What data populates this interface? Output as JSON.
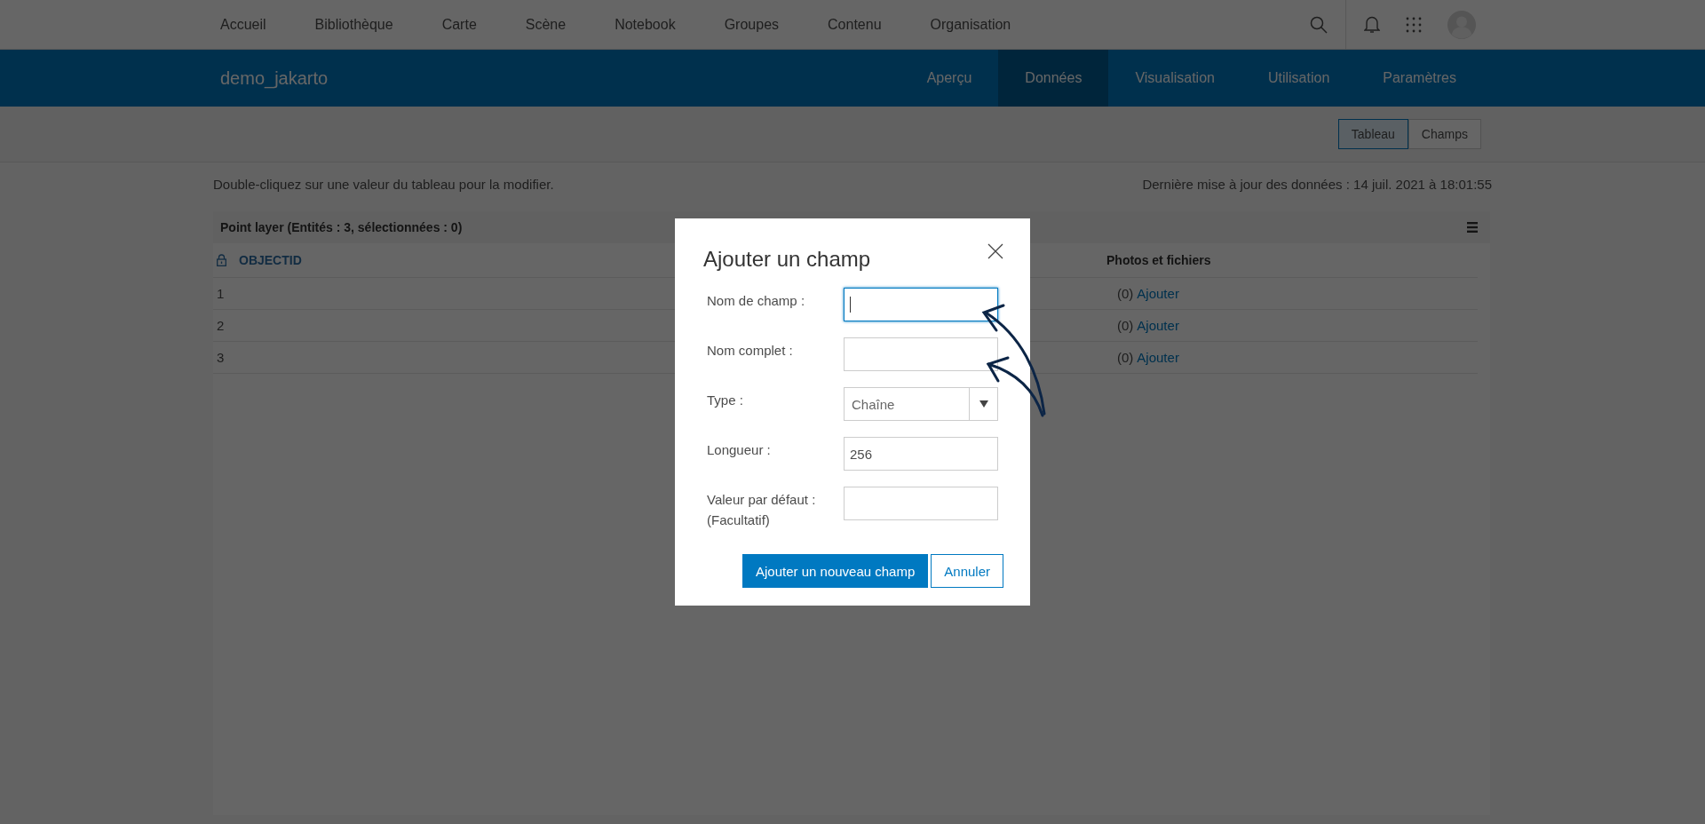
{
  "top_nav": {
    "items": [
      {
        "label": "Accueil"
      },
      {
        "label": "Bibliothèque"
      },
      {
        "label": "Carte"
      },
      {
        "label": "Scène"
      },
      {
        "label": "Notebook"
      },
      {
        "label": "Groupes"
      },
      {
        "label": "Contenu"
      },
      {
        "label": "Organisation"
      }
    ]
  },
  "item_header": {
    "title": "demo_jakarto",
    "tabs": [
      {
        "label": "Aperçu",
        "selected": false
      },
      {
        "label": "Données",
        "selected": true
      },
      {
        "label": "Visualisation",
        "selected": false
      },
      {
        "label": "Utilisation",
        "selected": false
      },
      {
        "label": "Paramètres",
        "selected": false
      }
    ]
  },
  "view_toggle": [
    {
      "label": "Tableau",
      "selected": true
    },
    {
      "label": "Champs",
      "selected": false
    }
  ],
  "hint": "Double-cliquez sur une valeur du tableau pour la modifier.",
  "last_update": "Dernière mise à jour des données : 14 juil. 2021 à 18:01:55",
  "table": {
    "title": "Point layer (Entités : 3, sélectionnées : 0)",
    "columns": [
      {
        "label": "OBJECTID",
        "locked": true
      },
      {
        "label": "Photos et fichiers",
        "locked": false
      }
    ],
    "rows": [
      {
        "id": "1",
        "count": "(0)",
        "link": "Ajouter"
      },
      {
        "id": "2",
        "count": "(0)",
        "link": "Ajouter"
      },
      {
        "id": "3",
        "count": "(0)",
        "link": "Ajouter"
      }
    ]
  },
  "dialog": {
    "title": "Ajouter un champ",
    "fields": [
      {
        "kind": "text",
        "label": "Nom de champ :",
        "focused": true
      },
      {
        "kind": "text",
        "label": "Nom complet :",
        "focused": false
      },
      {
        "kind": "select",
        "label": "Type :",
        "value": "Chaîne",
        "focused": false
      },
      {
        "kind": "text",
        "label": "Longueur :",
        "value": "256",
        "focused": false
      },
      {
        "kind": "text",
        "label": "Valeur par défaut :",
        "sublabel": "(Facultatif)",
        "focused": false
      }
    ],
    "primary_button": "Ajouter un nouveau champ",
    "cancel_button": "Annuler"
  }
}
